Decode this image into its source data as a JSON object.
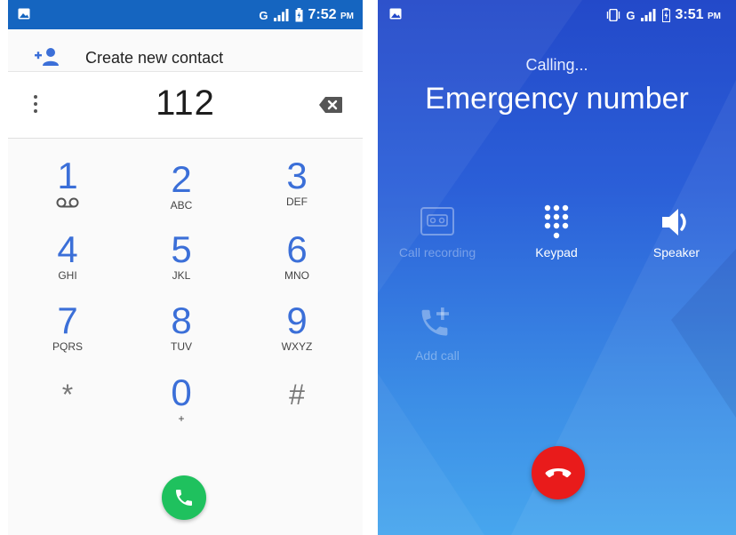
{
  "left": {
    "status": {
      "network": "G",
      "time": "7:52",
      "ampm": "PM"
    },
    "create_contact": {
      "label": "Create new contact"
    },
    "number": "112",
    "keypad": [
      {
        "digit": "1",
        "letters": ""
      },
      {
        "digit": "2",
        "letters": "ABC"
      },
      {
        "digit": "3",
        "letters": "DEF"
      },
      {
        "digit": "4",
        "letters": "GHI"
      },
      {
        "digit": "5",
        "letters": "JKL"
      },
      {
        "digit": "6",
        "letters": "MNO"
      },
      {
        "digit": "7",
        "letters": "PQRS"
      },
      {
        "digit": "8",
        "letters": "TUV"
      },
      {
        "digit": "9",
        "letters": "WXYZ"
      },
      {
        "digit": "*",
        "letters": ""
      },
      {
        "digit": "0",
        "letters": "+"
      },
      {
        "digit": "#",
        "letters": ""
      }
    ],
    "icons": [
      "image-icon",
      "signal-icon",
      "battery-icon",
      "add-contact-icon",
      "more-vert-icon",
      "backspace-icon",
      "voicemail-icon",
      "phone-icon"
    ]
  },
  "right": {
    "status": {
      "network": "G",
      "time": "3:51",
      "ampm": "PM"
    },
    "calling_label": "Calling...",
    "caller_name": "Emergency number",
    "controls": {
      "record": "Call recording",
      "keypad": "Keypad",
      "speaker": "Speaker",
      "add_call": "Add call"
    },
    "icons": [
      "image-icon",
      "vibrate-icon",
      "signal-icon",
      "battery-charging-icon",
      "cassette-icon",
      "dialpad-icon",
      "speaker-icon",
      "add-call-icon",
      "end-call-icon"
    ]
  },
  "colors": {
    "status_bar_left": "#1565c0",
    "digit_blue": "#3b6fd8",
    "call_green": "#1fc15e",
    "incall_blue_top": "#2349c9",
    "incall_blue_bottom": "#47a6ee",
    "end_call_red": "#e91b1b"
  }
}
